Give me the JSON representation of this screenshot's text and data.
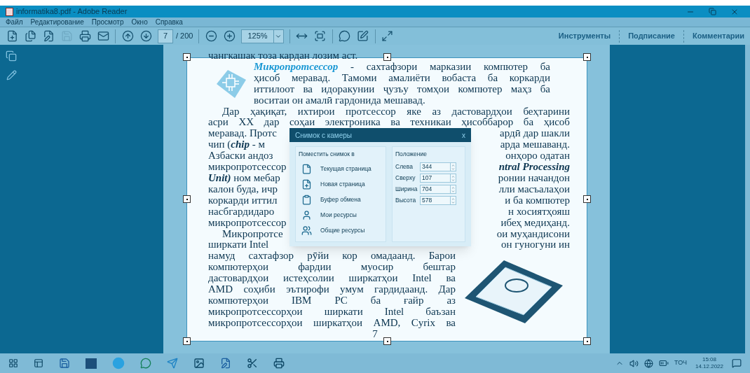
{
  "window": {
    "title": "informatika8.pdf - Adobe Reader"
  },
  "menu": [
    "Файл",
    "Редактирование",
    "Просмотр",
    "Окно",
    "Справка"
  ],
  "toolbar": {
    "page": "7",
    "page_count": "/ 200",
    "zoom": "125%",
    "save_disabled": true
  },
  "panels": [
    {
      "label": "Инструменты"
    },
    {
      "label": "Подписание"
    },
    {
      "label": "Комментарии"
    }
  ],
  "document": {
    "lead_line": "чангкашак тоза кардан лозим аст.",
    "definition": {
      "term": "Микропротсессор",
      "lines": [
        "- сахтафзори марказии компютер ба",
        "ҳисоб меравад. Тамоми амалиёти вобаста ба коркарди",
        "иттилоот ва идоракунии ҷузъу томҳои компютер маҳз ба",
        "воситаи он амалӣ гардонида мешавад."
      ]
    },
    "lines": [
      {
        "kind": "full",
        "indent": true,
        "text": "Дар ҳақиқат, ихтирои протсессор яке аз дастовардҳои беҳтарини"
      },
      {
        "kind": "full",
        "indent": false,
        "text": "асри XX дар соҳаи электроника ва техникаи ҳисоббарор ба ҳисоб"
      },
      {
        "kind": "split",
        "indent": false,
        "left": "меравад. Протс",
        "right": "ардӣ дар шакли"
      },
      {
        "kind": "split",
        "indent": false,
        "left": "чип (*chip* - м",
        "right": "арда мешаванд."
      },
      {
        "kind": "split",
        "indent": false,
        "left": "Азбаски андоз",
        "right": "онҳоро одатан"
      },
      {
        "kind": "split",
        "indent": false,
        "left": "микропротсессор",
        "right": "*ntral Processing*"
      },
      {
        "kind": "split",
        "indent": false,
        "left": "*Unit)* ном мебар",
        "right": "ронии начандон"
      },
      {
        "kind": "split",
        "indent": false,
        "left": "калон буда, ичр",
        "right": "лли масъалаҳои"
      },
      {
        "kind": "split",
        "indent": false,
        "left": "коркарди иттил",
        "right": "и ба компютер"
      },
      {
        "kind": "split",
        "indent": false,
        "left": "насбгардидаро",
        "right": "н хосиятҳояш"
      },
      {
        "kind": "split",
        "indent": false,
        "left": "микропротсессор",
        "right": "ибеҳ медиҳанд."
      },
      {
        "kind": "split",
        "indent": true,
        "left": "Микропротсе",
        "right": "ои муҳандисони"
      },
      {
        "kind": "split",
        "indent": false,
        "left": "ширкати Intel",
        "right": "он гуногуни ин"
      }
    ],
    "wrapped_lines": [
      "намуд сахтафзор рӯйи кор омадаанд. Барои",
      "компютерҳои фардии муосир бештар",
      "дастовардҳои истеҳсолии ширкатҳои Intel ва",
      "AMD соҳиби эътирофи умум гардидаанд. Дар",
      "компютерҳои IBM PC ба ғайр аз",
      "микропротсессорҳои ширкати Intel баъзан",
      "микропротсессорҳои ширкатҳои AMD, Cyrix ва"
    ],
    "page_number": "7"
  },
  "dialog": {
    "title": "Снимок с камеры",
    "close": "x",
    "targets_heading": "Поместить снимок в",
    "targets": [
      {
        "kind": "page",
        "label": "Текущая страница"
      },
      {
        "kind": "new-page",
        "label": "Новая страница"
      },
      {
        "kind": "clipboard",
        "label": "Буфер обмена"
      },
      {
        "kind": "user",
        "label": "Мои ресурсы"
      },
      {
        "kind": "users",
        "label": "Общие ресурсы"
      }
    ],
    "position_heading": "Положение",
    "fields": [
      {
        "label": "Слева",
        "value": "344"
      },
      {
        "label": "Сверху",
        "value": "107"
      },
      {
        "label": "Ширина",
        "value": "704"
      },
      {
        "label": "Высота",
        "value": "578"
      }
    ]
  },
  "taskbar": {
    "language": "ТОЧ",
    "time": "15:08",
    "date": "14.12.2022"
  }
}
